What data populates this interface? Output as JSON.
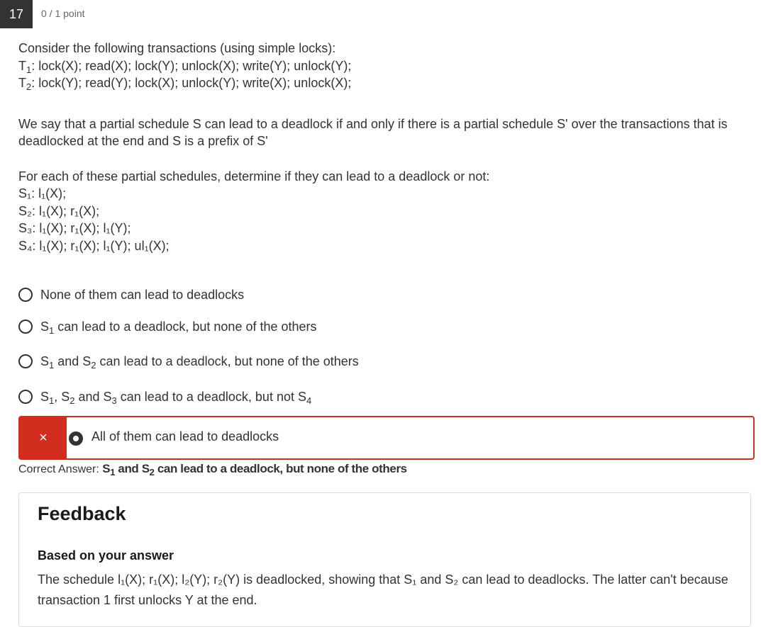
{
  "question": {
    "number": "17",
    "points": "0 / 1 point",
    "intro": "Consider the following transactions (using simple locks):",
    "t1_label": "T",
    "t1_sub": "1",
    "t1_ops": ": lock(X); read(X); lock(Y); unlock(X); write(Y); unlock(Y);",
    "t2_label": "T",
    "t2_sub": "2",
    "t2_ops": ": lock(Y); read(Y); lock(X); unlock(Y); write(X); unlock(X);",
    "definition": "We say that a partial schedule S can lead to a deadlock if and only if there is a partial schedule S' over the transactions that is deadlocked at the end and S is a prefix of S'",
    "prompt": "For each of these partial schedules, determine if they can lead to a deadlock or not:"
  },
  "schedules": {
    "s1": "S₁: l₁(X);",
    "s2": "S₂: l₁(X); r₁(X);",
    "s3": "S₃: l₁(X); r₁(X); l₁(Y);",
    "s4": "S₄: l₁(X); r₁(X); l₁(Y); ul₁(X);"
  },
  "options": {
    "o1": "None of them can lead to deadlocks",
    "o2_s": "S",
    "o2_sub": "1",
    "o2_rest": " can lead to a deadlock, but none of the others",
    "o3_a": "S",
    "o3_a_sub": "1",
    "o3_mid": " and S",
    "o3_b_sub": "2",
    "o3_rest": " can lead to a deadlock, but none of the others",
    "o4_a": "S",
    "o4_a_sub": "1",
    "o4_comma": ", S",
    "o4_b_sub": "2",
    "o4_and": " and S",
    "o4_c_sub": "3",
    "o4_rest": " can lead to a deadlock, but not S",
    "o4_d_sub": "4",
    "selected": "All of them can lead to deadlocks"
  },
  "wrong_mark": "×",
  "correct": {
    "label": "Correct Answer: ",
    "a": "S",
    "a_sub": "1",
    "mid": " and S",
    "b_sub": "2",
    "rest": " can lead to a deadlock, but none of the others"
  },
  "feedback": {
    "title": "Feedback",
    "subtitle": "Based on your answer",
    "body": "The schedule l₁(X); r₁(X); l₂(Y); r₂(Y) is deadlocked, showing that S₁ and S₂ can lead to deadlocks. The latter can't because transaction 1 first unlocks Y at the end."
  },
  "colors": {
    "error": "#d22d1f",
    "header_bg": "#333333"
  }
}
